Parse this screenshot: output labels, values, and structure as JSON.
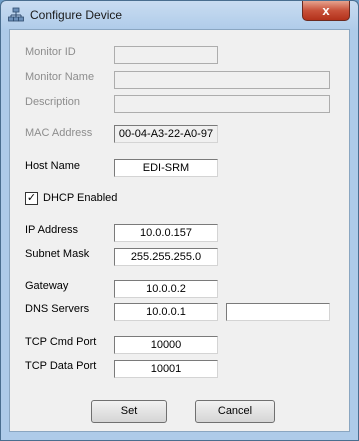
{
  "window": {
    "title": "Configure Device",
    "close_glyph": "x"
  },
  "icons": {
    "app": "network-devices-icon",
    "close": "close-icon"
  },
  "fields": {
    "monitor_id": {
      "label": "Monitor ID",
      "value": ""
    },
    "monitor_name": {
      "label": "Monitor Name",
      "value": ""
    },
    "description": {
      "label": "Description",
      "value": ""
    },
    "mac_address": {
      "label": "MAC Address",
      "value": "00-04-A3-22-A0-97"
    },
    "host_name": {
      "label": "Host Name",
      "value": "EDI-SRM"
    },
    "dhcp": {
      "label": "DHCP Enabled",
      "checked": true,
      "check_glyph": "✓"
    },
    "ip_address": {
      "label": "IP Address",
      "value": "10.0.0.157"
    },
    "subnet_mask": {
      "label": "Subnet Mask",
      "value": "255.255.255.0"
    },
    "gateway": {
      "label": "Gateway",
      "value": "10.0.0.2"
    },
    "dns_servers": {
      "label": "DNS Servers",
      "primary": "10.0.0.1",
      "secondary": ""
    },
    "tcp_cmd_port": {
      "label": "TCP Cmd Port",
      "value": "10000"
    },
    "tcp_data_port": {
      "label": "TCP Data Port",
      "value": "10001"
    }
  },
  "buttons": {
    "set": "Set",
    "cancel": "Cancel"
  }
}
